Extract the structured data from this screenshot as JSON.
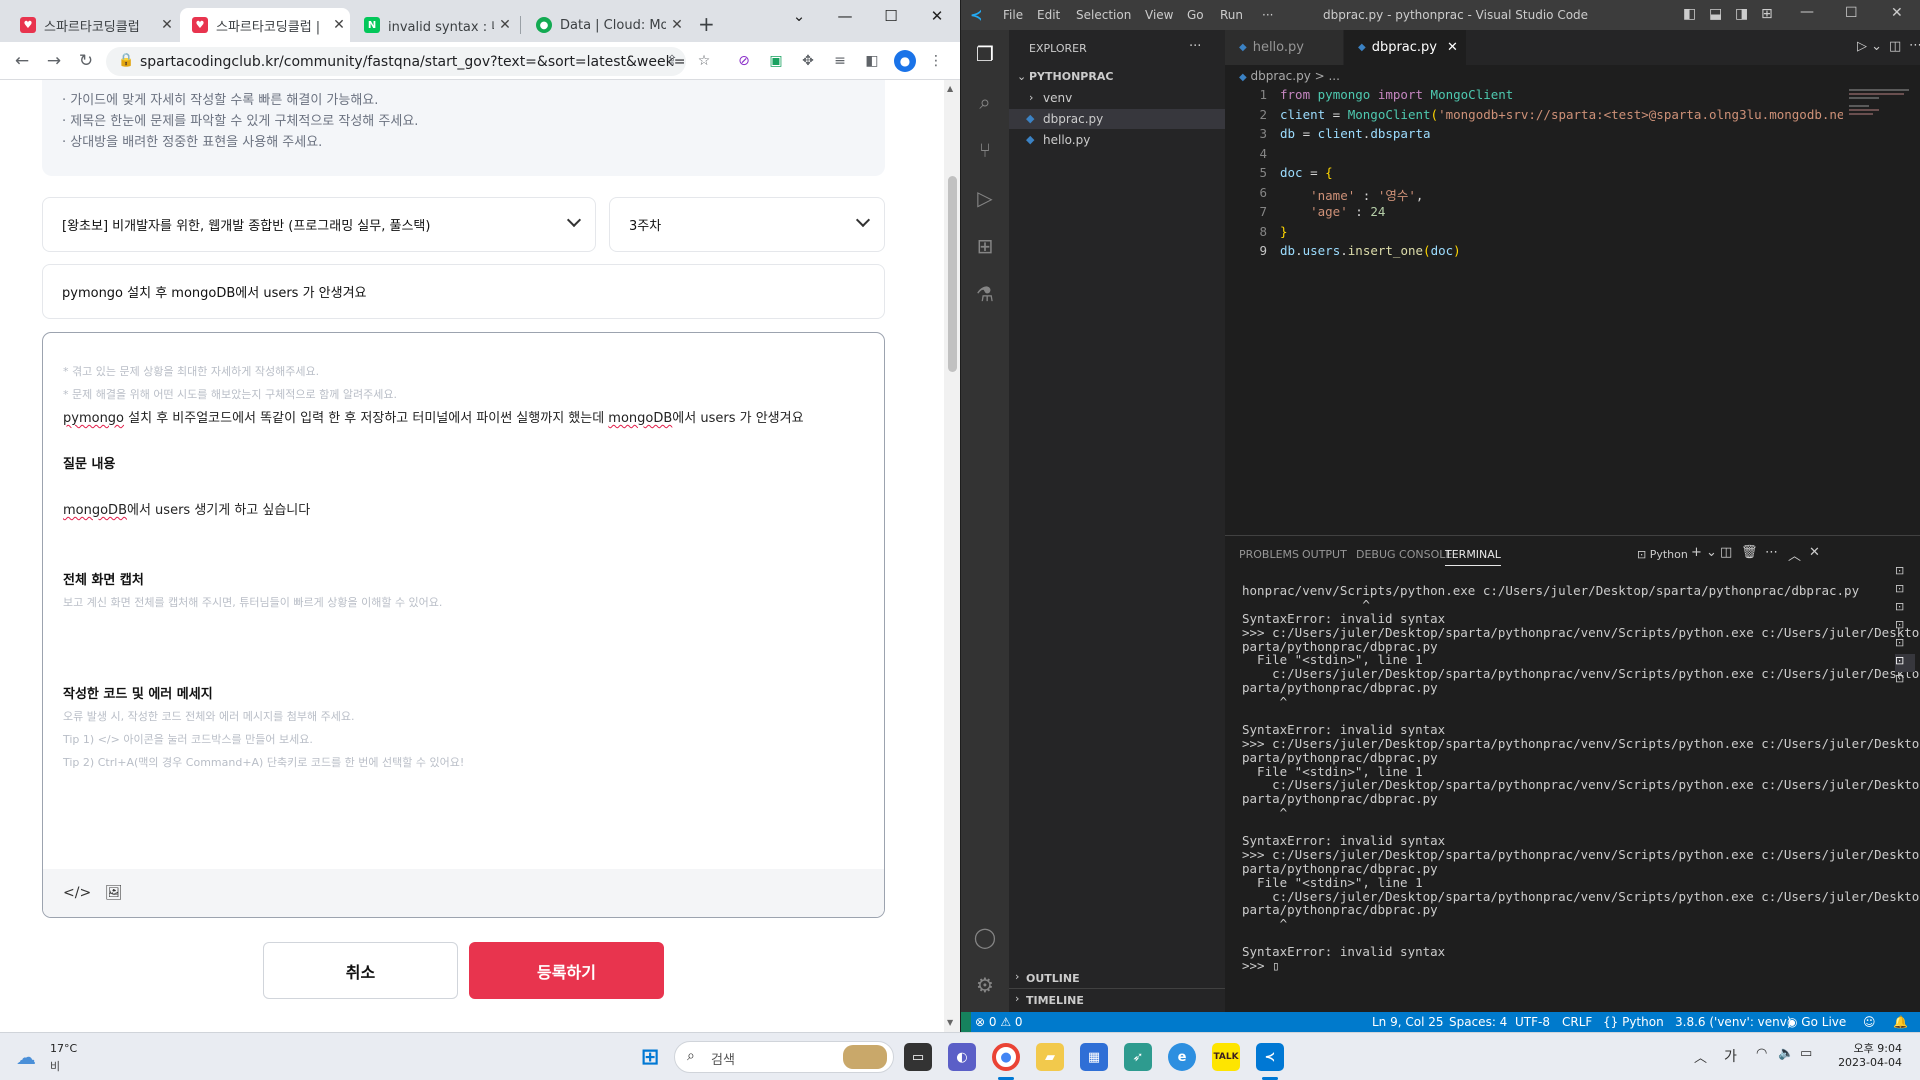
{
  "chrome": {
    "tabs": [
      {
        "title": "스파르타코딩클럽",
        "active": false
      },
      {
        "title": "스파르타코딩클럽 | ",
        "active": true
      },
      {
        "title": "invalid syntax : 네이",
        "active": false
      },
      {
        "title": "Data | Cloud: Mong",
        "active": false
      }
    ],
    "new_tab": "+",
    "url": "spartacodingclub.kr/community/fastqna/start_gov?text=&sort=latest&week=&...",
    "window": {
      "minimize": "—",
      "maximize": "☐",
      "close": "✕",
      "dropdown": "⌄"
    }
  },
  "page": {
    "guide_lines": [
      "· 가이드에 맞게 자세히 작성할 수록 빠른 해결이 가능해요.",
      "· 제목은 한눈에 문제를 파악할 수 있게 구체적으로 작성해 주세요.",
      "· 상대방을 배려한 정중한 표현을 사용해 주세요."
    ],
    "course_select": "[왕초보] 비개발자를 위한, 웹개발 종합반 (프로그래밍 실무, 풀스택)",
    "week_select": "3주차",
    "title_value": "pymongo 설치 후 mongoDB에서 users 가 안생겨요",
    "editor": {
      "hint1": "* 겪고 있는 문제 상황을 최대한 자세하게 작성해주세요.",
      "hint2": "* 문제 해결을 위해 어떤 시도를 해보았는지 구체적으로 함께 알려주세요.",
      "line1_a": "pymongo",
      "line1_b": " 설치 후 비주얼코드에서 똑같이 입력 한 후 저장하고 터미널에서 파이썬 실행까지 했는데 ",
      "line1_c": "mongoDB",
      "line1_d": "에서 users 가 안생겨요",
      "q_heading": "질문 내용",
      "q_body_a": "mongoDB",
      "q_body_b": "에서 users 생기게 하고 싶습니다",
      "cap_heading": "전체 화면 캡처",
      "cap_hint": "보고 계신 화면 전체를 캡처해 주시면, 튜터님들이 빠르게 상황을 이해할 수 있어요.",
      "code_heading": "작성한 코드 및 에러 메세지",
      "code_hint1": "오류 발생 시, 작성한 코드 전체와 에러 메시지를 첨부해 주세요.",
      "code_hint2": "Tip 1) </> 아이콘을 눌러 코드박스를 만들어 보세요.",
      "code_hint3": "Tip 2) Ctrl+A(맥의 경우 Command+A) 단축키로 코드를 한 번에 선택할 수 있어요!",
      "code_btn": "</>",
      "image_btn": "🖼"
    },
    "cancel_label": "취소",
    "submit_label": "등록하기"
  },
  "vscode": {
    "menus": [
      "File",
      "Edit",
      "Selection",
      "View",
      "Go",
      "Run",
      "···"
    ],
    "window_title": "dbprac.py - pythonprac - Visual Studio Code",
    "explorer_label": "EXPLORER",
    "explorer_more": "···",
    "folder": "PYTHONPRAC",
    "tree": [
      "venv",
      "dbprac.py",
      "hello.py"
    ],
    "outline": "OUTLINE",
    "timeline": "TIMELINE",
    "tabs": [
      "hello.py",
      "dbprac.py"
    ],
    "breadcrumb": "dbprac.py > ...",
    "code_lines": [
      {
        "n": "1",
        "parts": [
          [
            "kw",
            "from"
          ],
          [
            "pu",
            " "
          ],
          [
            "ns",
            "pymongo"
          ],
          [
            "pu",
            " "
          ],
          [
            "kw",
            "import"
          ],
          [
            "pu",
            " "
          ],
          [
            "ns",
            "MongoClient"
          ]
        ]
      },
      {
        "n": "2",
        "parts": [
          [
            "vr",
            "client"
          ],
          [
            "pu",
            " = "
          ],
          [
            "ns",
            "MongoClient"
          ],
          [
            "br",
            "("
          ],
          [
            "st",
            "'mongodb+srv://sparta:<test>@sparta.olng3lu.mongodb.ne"
          ]
        ]
      },
      {
        "n": "3",
        "parts": [
          [
            "vr",
            "db"
          ],
          [
            "pu",
            " = "
          ],
          [
            "vr",
            "client"
          ],
          [
            "pu",
            "."
          ],
          [
            "vr",
            "dbsparta"
          ]
        ]
      },
      {
        "n": "4",
        "parts": []
      },
      {
        "n": "5",
        "parts": [
          [
            "vr",
            "doc"
          ],
          [
            "pu",
            " = "
          ],
          [
            "br",
            "{"
          ]
        ]
      },
      {
        "n": "6",
        "parts": [
          [
            "pu",
            "    "
          ],
          [
            "st",
            "'name'"
          ],
          [
            "pu",
            " : "
          ],
          [
            "st",
            "'영수'"
          ],
          [
            "pu",
            ","
          ]
        ]
      },
      {
        "n": "7",
        "parts": [
          [
            "pu",
            "    "
          ],
          [
            "st",
            "'age'"
          ],
          [
            "pu",
            " : "
          ],
          [
            "nm",
            "24"
          ]
        ]
      },
      {
        "n": "8",
        "parts": [
          [
            "br",
            "}"
          ]
        ]
      },
      {
        "n": "9",
        "parts": [
          [
            "vr",
            "db"
          ],
          [
            "pu",
            "."
          ],
          [
            "vr",
            "users"
          ],
          [
            "pu",
            "."
          ],
          [
            "fn",
            "insert_one"
          ],
          [
            "br",
            "("
          ],
          [
            "vr",
            "doc"
          ],
          [
            "br",
            ")"
          ]
        ]
      }
    ],
    "panel_tabs": [
      "PROBLEMS",
      "OUTPUT",
      "DEBUG CONSOLE",
      "TERMINAL"
    ],
    "terminal_name": "Python",
    "terminal_lines": [
      "honprac/venv/Scripts/python.exe c:/Users/juler/Desktop/sparta/pythonprac/dbprac.py",
      "                ^",
      "SyntaxError: invalid syntax",
      ">>> c:/Users/juler/Desktop/sparta/pythonprac/venv/Scripts/python.exe c:/Users/juler/Desktop/s",
      "parta/pythonprac/dbprac.py",
      "  File \"<stdin>\", line 1",
      "    c:/Users/juler/Desktop/sparta/pythonprac/venv/Scripts/python.exe c:/Users/juler/Desktop/s",
      "parta/pythonprac/dbprac.py",
      "     ^",
      "",
      "SyntaxError: invalid syntax",
      ">>> c:/Users/juler/Desktop/sparta/pythonprac/venv/Scripts/python.exe c:/Users/juler/Desktop/s",
      "parta/pythonprac/dbprac.py",
      "  File \"<stdin>\", line 1",
      "    c:/Users/juler/Desktop/sparta/pythonprac/venv/Scripts/python.exe c:/Users/juler/Desktop/s",
      "parta/pythonprac/dbprac.py",
      "     ^",
      "",
      "SyntaxError: invalid syntax",
      ">>> c:/Users/juler/Desktop/sparta/pythonprac/venv/Scripts/python.exe c:/Users/juler/Desktop/s",
      "parta/pythonprac/dbprac.py",
      "  File \"<stdin>\", line 1",
      "    c:/Users/juler/Desktop/sparta/pythonprac/venv/Scripts/python.exe c:/Users/juler/Desktop/s",
      "parta/pythonprac/dbprac.py",
      "     ^",
      "",
      "SyntaxError: invalid syntax",
      ">>> ▯"
    ],
    "status": {
      "problems": "⊗ 0 ⚠ 0",
      "position": "Ln 9, Col 25",
      "spaces": "Spaces: 4",
      "encoding": "UTF-8",
      "eol": "CRLF",
      "language": "Python",
      "interpreter": "3.8.6 ('venv': venv)",
      "golive": "Go Live"
    }
  },
  "taskbar": {
    "weather_temp": "17°C",
    "weather_desc": "비",
    "search_placeholder": "검색",
    "ime": "가",
    "time": "오후 9:04",
    "date": "2023-04-04"
  },
  "colors": {
    "accent_red": "#e8344e",
    "vscode_blue": "#007acc"
  }
}
